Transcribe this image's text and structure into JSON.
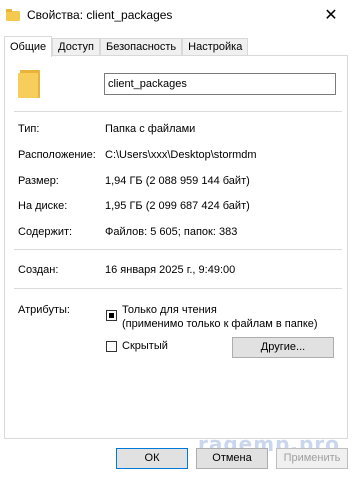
{
  "window": {
    "title": "Свойства: client_packages",
    "close_glyph": "✕"
  },
  "tabs": [
    {
      "label": "Общие",
      "active": true
    },
    {
      "label": "Доступ",
      "active": false
    },
    {
      "label": "Безопасность",
      "active": false
    },
    {
      "label": "Настройка",
      "active": false
    }
  ],
  "general": {
    "folder_name": "client_packages",
    "type_label": "Тип:",
    "type_value": "Папка с файлами",
    "location_label": "Расположение:",
    "location_value": "C:\\Users\\xxx\\Desktop\\stormdm",
    "size_label": "Размер:",
    "size_value": "1,94 ГБ (2 088 959 144 байт)",
    "ondisk_label": "На диске:",
    "ondisk_value": "1,95 ГБ (2 099 687 424 байт)",
    "contains_label": "Содержит:",
    "contains_value": "Файлов: 5 605; папок: 383",
    "created_label": "Создан:",
    "created_value": "16 января 2025 г., 9:49:00",
    "attributes_label": "Атрибуты:",
    "readonly_label_line1": "Только для чтения",
    "readonly_label_line2": "(применимо только к файлам в папке)",
    "hidden_label": "Скрытый",
    "other_button": "Другие..."
  },
  "buttons": {
    "ok": "ОК",
    "cancel": "Отмена",
    "apply": "Применить"
  },
  "watermark": "ragemp.pro"
}
